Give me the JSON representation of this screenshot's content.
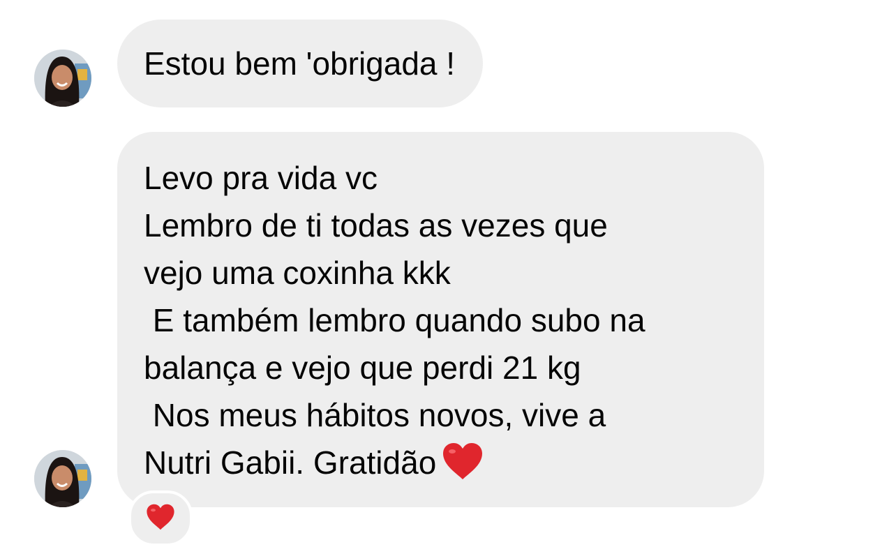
{
  "messages": [
    {
      "lines": [
        "Estou bem 'obrigada !"
      ]
    },
    {
      "lines": [
        "Levo pra vida vc",
        "Lembro de ti todas as vezes que",
        "vejo uma coxinha kkk",
        " E também lembro quando subo na",
        "balança e vejo que perdi 21 kg",
        " Nos meus hábitos novos, vive a",
        "Nutri Gabii. Gratidão"
      ],
      "trailing_emoji": "red-heart-icon",
      "reaction": "red-heart-icon"
    }
  ],
  "colors": {
    "background": "#ffffff",
    "bubble": "#eeeeee",
    "text": "#050505",
    "heart": "#e0262d"
  }
}
